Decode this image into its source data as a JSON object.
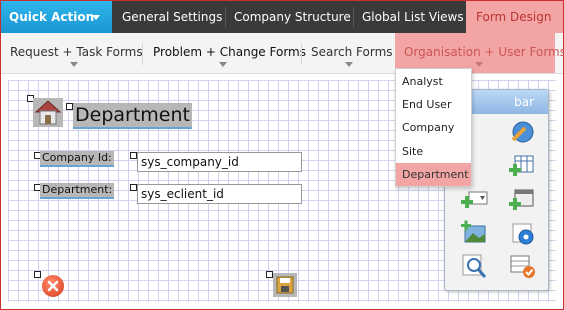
{
  "top_tabs": [
    {
      "label": "Quick Action"
    },
    {
      "label": "General Settings"
    },
    {
      "label": "Company Structure"
    },
    {
      "label": "Global List Views"
    },
    {
      "label": "Form Design"
    }
  ],
  "sub_tabs": [
    {
      "label": "Request + Task Forms"
    },
    {
      "label": "Problem + Change Forms"
    },
    {
      "label": "Search Forms"
    },
    {
      "label": "Organisation + User Forms"
    }
  ],
  "dropdown": {
    "items": [
      {
        "label": "Analyst"
      },
      {
        "label": "End User"
      },
      {
        "label": "Company"
      },
      {
        "label": "Site"
      },
      {
        "label": "Department"
      }
    ],
    "selected": "Department"
  },
  "form": {
    "title": "Department",
    "fields": [
      {
        "label": "Company Id:",
        "value": "sys_company_id"
      },
      {
        "label": "Department:",
        "value": "sys_eclient_id"
      }
    ]
  },
  "toolbar": {
    "title": "bar",
    "tools": [
      "globe-edit-icon",
      "add-table-icon",
      "add-dropdown-icon",
      "add-window-icon",
      "add-image-icon",
      "gear-icon",
      "search-preview-icon",
      "check-table-icon"
    ]
  },
  "colors": {
    "quick_action_bg": "#1a95d3",
    "top_bar_bg": "#3a3a3a",
    "active_tab_bg": "#f3a5a5",
    "frame_border": "#c9302c",
    "grid_line": "#cfd3ef"
  }
}
